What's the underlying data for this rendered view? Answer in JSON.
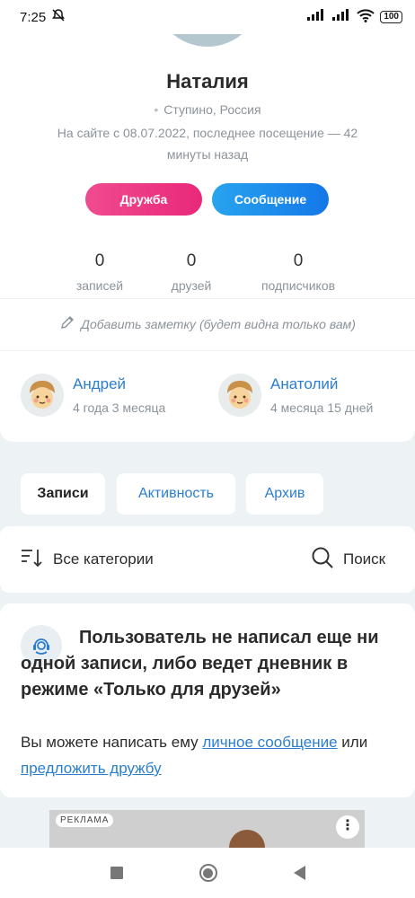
{
  "status_bar": {
    "time": "7:25",
    "battery": "100"
  },
  "profile": {
    "name": "Наталия",
    "location": "Ступино, Россия",
    "seen": "На сайте с 08.07.2022, последнее посещение — 42 минуты назад",
    "friend_button": "Дружба",
    "message_button": "Сообщение",
    "stats": [
      {
        "value": "0",
        "label": "записей"
      },
      {
        "value": "0",
        "label": "друзей"
      },
      {
        "value": "0",
        "label": "подписчиков"
      }
    ],
    "note_placeholder": "Добавить заметку (будет видна только вам)"
  },
  "friends": [
    {
      "name": "Андрей",
      "duration": "4 года 3 месяца"
    },
    {
      "name": "Анатолий",
      "duration": "4 месяца 15 дней"
    }
  ],
  "tabs": [
    {
      "label": "Записи",
      "active": true
    },
    {
      "label": "Активность",
      "active": false
    },
    {
      "label": "Архив",
      "active": false
    }
  ],
  "filters": {
    "categories": "Все категории",
    "search": "Поиск"
  },
  "empty_state": {
    "title": "Пользователь не написал еще ни одной записи, либо ведет дневник в режиме «Только для друзей»",
    "body_prefix": "Вы можете написать ему ",
    "link_message": "личное сообщение",
    "body_middle": " или ",
    "link_friend": "предложить дружбу"
  },
  "ad": {
    "badge": "РЕКЛАМА",
    "more": "⋮"
  },
  "colors": {
    "accent_blue": "#2a7ed0",
    "friend_pink": "#e9287a",
    "message_blue": "#1477e8"
  }
}
